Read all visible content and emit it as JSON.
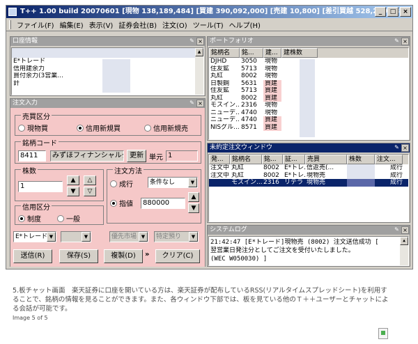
{
  "window": {
    "title": "T++ 1.00 build 20070601 [現物 138,189,484] [買建 390,092,000] [売建 10,800] [差引買越 528,270,684]",
    "min_label": "_",
    "max_label": "□",
    "close_label": "×"
  },
  "menu": [
    "ファイル(F)",
    "編集(E)",
    "表示(V)",
    "証券会社(B)",
    "注文(O)",
    "ツール(T)",
    "ヘルプ(H)"
  ],
  "account_panel": {
    "title": "口座情報",
    "rows": [
      "E*トレード",
      "信用建余力",
      "買付余力(3営業...",
      "計"
    ]
  },
  "portfolio_panel": {
    "title": "ポートフォリオ",
    "columns": [
      "銘柄名",
      "銘...",
      "建...",
      "建株数"
    ],
    "rows": [
      {
        "name": "DJHD",
        "code": "3050",
        "type": "現物"
      },
      {
        "name": "住友鉱",
        "code": "5713",
        "type": "現物"
      },
      {
        "name": "丸紅",
        "code": "8002",
        "type": "現物"
      },
      {
        "name": "日製鋼",
        "code": "5631",
        "type": "買建"
      },
      {
        "name": "住友鉱",
        "code": "5713",
        "type": "買建"
      },
      {
        "name": "丸紅",
        "code": "8002",
        "type": "買建"
      },
      {
        "name": "モスイン...",
        "code": "2316",
        "type": "現物"
      },
      {
        "name": "ニューデ...",
        "code": "4740",
        "type": "現物"
      },
      {
        "name": "ニューデ...",
        "code": "4740",
        "type": "買建"
      },
      {
        "name": "NISグル...",
        "code": "8571",
        "type": "買建"
      }
    ]
  },
  "order_panel": {
    "title": "注文入力",
    "side_group": "売買区分",
    "side_options": [
      "現物買",
      "信用新規買",
      "信用新規売"
    ],
    "code_group": "銘柄コード",
    "code_value": "8411",
    "name_value": "みずほフィナンシャルグ",
    "refresh_label": "更新",
    "unit_label": "単元",
    "unit_value": "1",
    "qty_group": "株数",
    "qty_value": "1",
    "method_group": "注文方法",
    "market_label": "成行",
    "condition_value": "条件なし",
    "limit_label": "指値",
    "price_value": "880000",
    "credit_group": "信用区分",
    "credit_options": [
      "制度",
      "一般"
    ],
    "broker_value": "E*トレード",
    "priority_market": "優先市場",
    "specific_account": "特定預り",
    "send_label": "送信(R)",
    "save_label": "保存(S)",
    "copy_label": "複製(D)",
    "more_label": "»",
    "clear_label": "クリア(C)"
  },
  "open_orders_panel": {
    "title": "未約定注文ウィンドウ",
    "columns": [
      "発...",
      "銘柄名",
      "銘...",
      "証...",
      "売買",
      "株数",
      "注文..."
    ],
    "rows": [
      {
        "status": "注文中",
        "name": "丸紅",
        "code": "8002",
        "broker": "E*トレ...",
        "side": "信返売(...",
        "order_type": "成行",
        "selected": false
      },
      {
        "status": "注文中",
        "name": "丸紅",
        "code": "8002",
        "broker": "E*トレ...",
        "side": "現物売",
        "order_type": "成行",
        "selected": false
      },
      {
        "status": "",
        "name": "モスイン...",
        "code": "2316",
        "broker": "リテラ・...",
        "side": "現物売",
        "order_type": "成行",
        "selected": true
      }
    ]
  },
  "system_log_panel": {
    "title": "システムログ",
    "lines": [
      "21:42:47 [E*トレード]現物売 (8002) 注文送信成功 [",
      "翌営業日発注分としてご注文を受付いたしました。",
      "(WEC W050030) ]"
    ]
  },
  "caption": {
    "text": "5.板チャット画面　楽天証券に口座を開いている方は、楽天証券が配布しているRSS(リアルタイムスプレッドシート)を利用することで、銘柄の情報を見ることができます。また、各ウィンドウ下部では、板を見ている他のＴ＋＋ユーザーとチャットによる会話が可能です。",
    "image_count": "Image 5 of 5"
  },
  "colors": {
    "title_active": "#0a246a",
    "title_inactive": "#a0a0a0",
    "order_panel_bg": "#f5c8c8",
    "window_bg": "#d4d0c8"
  }
}
